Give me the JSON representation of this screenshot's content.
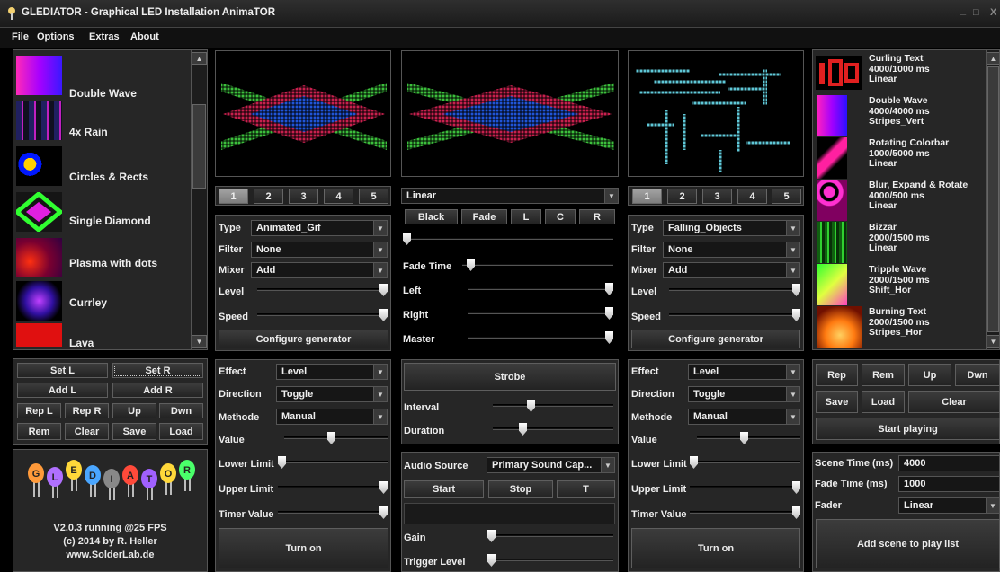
{
  "window": {
    "title": "GLEDIATOR - Graphical LED Installation AnimaTOR",
    "controls": [
      "_",
      "□",
      "X"
    ]
  },
  "menu": [
    "File",
    "Options",
    "Extras",
    "About"
  ],
  "gen_list": {
    "items": [
      "Double Wave",
      "4x Rain",
      "Circles & Rects",
      "Single Diamond",
      "Plasma with dots",
      "Currley",
      "Lava"
    ]
  },
  "list_buttons": {
    "set_l": "Set L",
    "set_r": "Set R",
    "add_l": "Add L",
    "add_r": "Add R",
    "rep_l": "Rep L",
    "rep_r": "Rep R",
    "up": "Up",
    "dwn": "Dwn",
    "rem": "Rem",
    "clear": "Clear",
    "save": "Save",
    "load": "Load"
  },
  "logo": {
    "letters": [
      "G",
      "L",
      "E",
      "D",
      "I",
      "A",
      "T",
      "O",
      "R"
    ],
    "version": "V2.0.3 running @25 FPS",
    "copyright": "(c) 2014 by R. Heller",
    "website": "www.SolderLab.de"
  },
  "tabs": [
    "1",
    "2",
    "3",
    "4",
    "5"
  ],
  "left_gen": {
    "type_label": "Type",
    "type": "Animated_Gif",
    "filter_label": "Filter",
    "filter": "None",
    "mixer_label": "Mixer",
    "mixer": "Add",
    "level_label": "Level",
    "speed_label": "Speed",
    "configure": "Configure generator"
  },
  "right_gen": {
    "type_label": "Type",
    "type": "Falling_Objects",
    "filter_label": "Filter",
    "filter": "None",
    "mixer_label": "Mixer",
    "mixer": "Add",
    "level_label": "Level",
    "speed_label": "Speed",
    "configure": "Configure generator"
  },
  "fader": {
    "mode": "Linear",
    "black": "Black",
    "fade": "Fade",
    "l": "L",
    "c": "C",
    "r": "R",
    "fade_time": "Fade Time",
    "left": "Left",
    "right": "Right",
    "master": "Master"
  },
  "left_fx": {
    "effect_label": "Effect",
    "effect": "Level",
    "direction_label": "Direction",
    "direction": "Toggle",
    "methode_label": "Methode",
    "methode": "Manual",
    "value_label": "Value",
    "lower": "Lower Limit",
    "upper": "Upper Limit",
    "timer": "Timer Value",
    "turn_on": "Turn on"
  },
  "right_fx": {
    "effect_label": "Effect",
    "effect": "Level",
    "direction_label": "Direction",
    "direction": "Toggle",
    "methode_label": "Methode",
    "methode": "Manual",
    "value_label": "Value",
    "lower": "Lower Limit",
    "upper": "Upper Limit",
    "timer": "Timer Value",
    "turn_on": "Turn on"
  },
  "strobe": {
    "label": "Strobe",
    "interval": "Interval",
    "duration": "Duration"
  },
  "audio": {
    "source_label": "Audio Source",
    "source": "Primary Sound Cap...",
    "start": "Start",
    "stop": "Stop",
    "t": "T",
    "gain": "Gain",
    "trigger": "Trigger Level"
  },
  "scenes": [
    {
      "name": "Curling Text",
      "time": "4000/1000 ms",
      "fader": "Linear"
    },
    {
      "name": "Double Wave",
      "time": "4000/4000 ms",
      "fader": "Stripes_Vert"
    },
    {
      "name": "Rotating Colorbar",
      "time": "1000/5000 ms",
      "fader": "Linear"
    },
    {
      "name": "Blur, Expand & Rotate",
      "time": "4000/500 ms",
      "fader": "Linear"
    },
    {
      "name": "Bizzar",
      "time": "2000/1500 ms",
      "fader": "Linear"
    },
    {
      "name": "Tripple Wave",
      "time": "2000/1500 ms",
      "fader": "Shift_Hor"
    },
    {
      "name": "Burning Text",
      "time": "2000/1500 ms",
      "fader": "Stripes_Hor"
    }
  ],
  "scene_buttons": {
    "rep": "Rep",
    "rem": "Rem",
    "up": "Up",
    "dwn": "Dwn",
    "save": "Save",
    "load": "Load",
    "clear": "Clear",
    "start": "Start playing"
  },
  "scene_settings": {
    "scene_time_label": "Scene Time (ms)",
    "scene_time": "4000",
    "fade_time_label": "Fade Time (ms)",
    "fade_time": "1000",
    "fader_label": "Fader",
    "fader": "Linear",
    "add": "Add scene to play list"
  },
  "sliders": {
    "left_level": 1.0,
    "left_speed": 1.0,
    "fade_pos": 0.0,
    "fade_time": 0.03,
    "left_mix": 1.0,
    "right_mix": 1.0,
    "master": 1.0,
    "right_level": 1.0,
    "right_speed": 1.0,
    "lf_value": 0.45,
    "lf_lower": 0.0,
    "lf_upper": 1.0,
    "lf_timer": 1.0,
    "interval": 0.3,
    "duration": 0.23,
    "rf_value": 0.45,
    "rf_lower": 0.0,
    "rf_upper": 1.0,
    "rf_timer": 1.0,
    "gain": 0.0,
    "trigger": 0.0
  }
}
